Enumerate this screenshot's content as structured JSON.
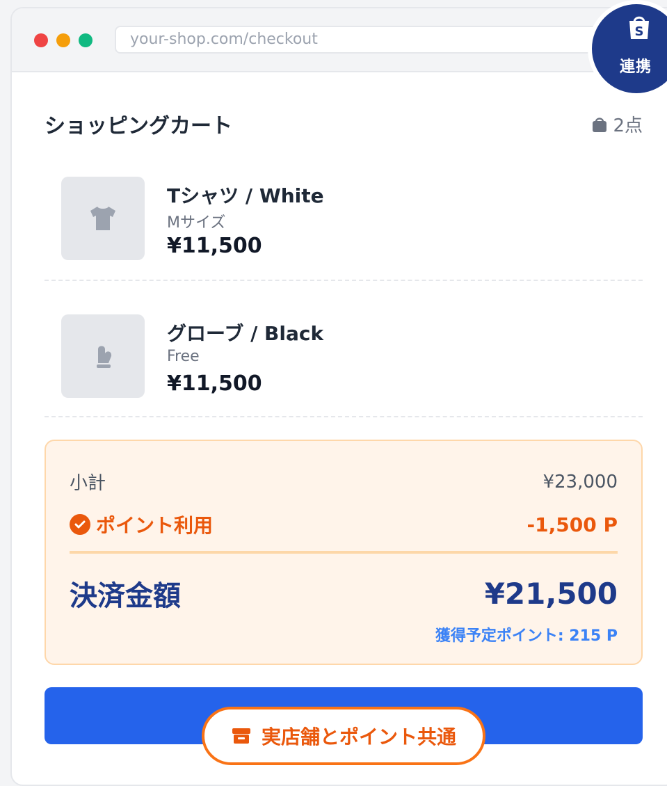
{
  "browser": {
    "url": "your-shop.com/checkout"
  },
  "badge": {
    "icon": "shopify-bag-icon",
    "label": "連携",
    "color": "#1e3a8a"
  },
  "cart": {
    "title": "ショッピングカート",
    "count": "2点",
    "items": [
      {
        "name": "Tシャツ / White",
        "variant": "Mサイズ",
        "price": "¥11,500",
        "icon": "tshirt-icon"
      },
      {
        "name": "グローブ / Black",
        "variant": "Free",
        "price": "¥11,500",
        "icon": "mitten-icon"
      }
    ]
  },
  "summary": {
    "subtotal_label": "小計",
    "subtotal_value": "¥23,000",
    "points_label": "ポイント利用",
    "points_value": "-1,500 P",
    "total_label": "決済金額",
    "total_value": "¥21,500",
    "earn_label": "獲得予定ポイント: 215 P"
  },
  "footer": {
    "store_label": "実店舗とポイント共通",
    "accent": "#f97316",
    "button_color": "#2563eb"
  }
}
